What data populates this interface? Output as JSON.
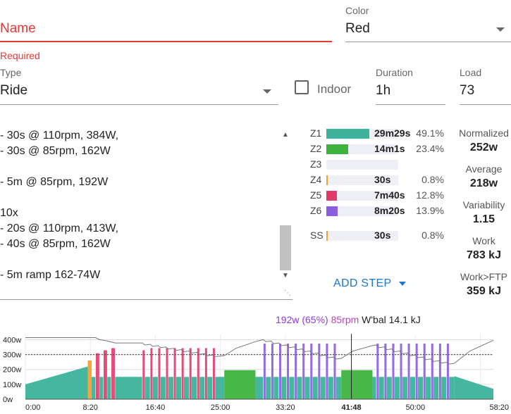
{
  "form": {
    "name_placeholder": "Name",
    "required_text": "Required",
    "color_label": "Color",
    "color_value": "Red",
    "type_label": "Type",
    "type_value": "Ride",
    "indoor_label": "Indoor",
    "indoor_checked": false,
    "duration_label": "Duration",
    "duration_value": "1h",
    "load_label": "Load",
    "load_value": "73"
  },
  "workout_lines": [
    "- 30s @ 110rpm, 384W,",
    "- 30s @ 85rpm, 162W",
    "",
    "- 5m @ 85rpm, 192W",
    "",
    "10x",
    "- 20s @ 110rpm, 413W,",
    "- 40s @ 85rpm, 162W",
    "",
    "- 5m ramp 162-74W"
  ],
  "zones": [
    {
      "label": "Z1",
      "time": "29m29s",
      "pct": "49.1%",
      "fill": 0.6,
      "color": "#3cb39a"
    },
    {
      "label": "Z2",
      "time": "14m1s",
      "pct": "23.4%",
      "fill": 0.3,
      "color": "#3db33d"
    },
    {
      "label": "Z3",
      "time": "",
      "pct": "",
      "fill": 0,
      "color": "#e0b030"
    },
    {
      "label": "Z4",
      "time": "30s",
      "pct": "0.8%",
      "fill": 0.02,
      "color": "#f5a030"
    },
    {
      "label": "Z5",
      "time": "7m40s",
      "pct": "12.8%",
      "fill": 0.15,
      "color": "#e03a6a"
    },
    {
      "label": "Z6",
      "time": "8m20s",
      "pct": "13.9%",
      "fill": 0.16,
      "color": "#8a5ce0"
    }
  ],
  "ss": {
    "label": "SS",
    "time": "30s",
    "pct": "0.8%",
    "fill": 0.02,
    "color": "#f5a030"
  },
  "stats": [
    {
      "label": "Normalized",
      "value": "252w"
    },
    {
      "label": "Average",
      "value": "218w"
    },
    {
      "label": "Variability",
      "value": "1.15"
    },
    {
      "label": "Work",
      "value": "783 kJ"
    },
    {
      "label": "Work>FTP",
      "value": "359 kJ"
    }
  ],
  "add_step_label": "ADD STEP",
  "colors": {
    "accent": "#1976d2",
    "error": "#e53935",
    "z1": "#3cb39a",
    "z2": "#3db33d",
    "z4": "#f5a030",
    "z5": "#e03a6a",
    "z6": "#8a5ce0"
  },
  "chart_header": {
    "power": "192w (65%)",
    "cadence": "85rpm",
    "wbal": "W'bal 14.1 kJ"
  },
  "chart_data": {
    "type": "area",
    "x_unit": "elapsed time",
    "x_tick_labels": [
      "0:00",
      "8:20",
      "16:40",
      "25:00",
      "33:20",
      "41:48",
      "50:00",
      "58:20"
    ],
    "x_tick_minutes": [
      0,
      8.333,
      16.667,
      25,
      33.333,
      41.8,
      50,
      58.333
    ],
    "y_tick_labels": [
      "0w",
      "100w",
      "200w",
      "300w",
      "400w"
    ],
    "ylim": [
      0,
      440
    ],
    "ftp_line_w": 300,
    "cursor_minutes": 41.8,
    "total_minutes": 60,
    "segments": [
      {
        "start": 0,
        "end": 8,
        "from_w": 100,
        "to_w": 220,
        "zone": "z1"
      },
      {
        "start": 8,
        "end": 8.5,
        "from_w": 260,
        "to_w": 260,
        "zone": "z4"
      },
      {
        "start": 8.5,
        "end": 9,
        "from_w": 150,
        "to_w": 150,
        "zone": "z1"
      },
      {
        "start": 9,
        "end": 9.5,
        "from_w": 310,
        "to_w": 310,
        "zone": "z5"
      },
      {
        "start": 9.5,
        "end": 10,
        "from_w": 150,
        "to_w": 150,
        "zone": "z1"
      },
      {
        "start": 10,
        "end": 10.5,
        "from_w": 330,
        "to_w": 330,
        "zone": "z5"
      },
      {
        "start": 10.5,
        "end": 11,
        "from_w": 150,
        "to_w": 150,
        "zone": "z1"
      },
      {
        "start": 11,
        "end": 11.5,
        "from_w": 345,
        "to_w": 345,
        "zone": "z5"
      },
      {
        "start": 11.5,
        "end": 15,
        "from_w": 150,
        "to_w": 150,
        "zone": "z1"
      },
      {
        "start": 15,
        "end": 15.33,
        "from_w": 330,
        "to_w": 330,
        "zone": "z5"
      },
      {
        "start": 15.33,
        "end": 16,
        "from_w": 150,
        "to_w": 150,
        "zone": "z1"
      },
      {
        "start": 16,
        "end": 16.33,
        "from_w": 345,
        "to_w": 345,
        "zone": "z5"
      },
      {
        "start": 16.33,
        "end": 17,
        "from_w": 150,
        "to_w": 150,
        "zone": "z1"
      },
      {
        "start": 17,
        "end": 17.33,
        "from_w": 345,
        "to_w": 345,
        "zone": "z5"
      },
      {
        "start": 17.33,
        "end": 18,
        "from_w": 150,
        "to_w": 150,
        "zone": "z1"
      },
      {
        "start": 18,
        "end": 18.33,
        "from_w": 345,
        "to_w": 345,
        "zone": "z5"
      },
      {
        "start": 18.33,
        "end": 19,
        "from_w": 150,
        "to_w": 150,
        "zone": "z1"
      },
      {
        "start": 19,
        "end": 19.33,
        "from_w": 345,
        "to_w": 345,
        "zone": "z5"
      },
      {
        "start": 19.33,
        "end": 20,
        "from_w": 150,
        "to_w": 150,
        "zone": "z1"
      },
      {
        "start": 20,
        "end": 20.33,
        "from_w": 345,
        "to_w": 345,
        "zone": "z5"
      },
      {
        "start": 20.33,
        "end": 21,
        "from_w": 150,
        "to_w": 150,
        "zone": "z1"
      },
      {
        "start": 21,
        "end": 21.33,
        "from_w": 345,
        "to_w": 345,
        "zone": "z5"
      },
      {
        "start": 21.33,
        "end": 22,
        "from_w": 150,
        "to_w": 150,
        "zone": "z1"
      },
      {
        "start": 22,
        "end": 22.33,
        "from_w": 345,
        "to_w": 345,
        "zone": "z5"
      },
      {
        "start": 22.33,
        "end": 23,
        "from_w": 150,
        "to_w": 150,
        "zone": "z1"
      },
      {
        "start": 23,
        "end": 23.33,
        "from_w": 345,
        "to_w": 345,
        "zone": "z5"
      },
      {
        "start": 23.33,
        "end": 24,
        "from_w": 150,
        "to_w": 150,
        "zone": "z1"
      },
      {
        "start": 24,
        "end": 24.33,
        "from_w": 345,
        "to_w": 345,
        "zone": "z5"
      },
      {
        "start": 24.33,
        "end": 25.5,
        "from_w": 150,
        "to_w": 150,
        "zone": "z1"
      },
      {
        "start": 25.5,
        "end": 29.5,
        "from_w": 195,
        "to_w": 195,
        "zone": "z2"
      },
      {
        "start": 29.5,
        "end": 30.5,
        "from_w": 150,
        "to_w": 150,
        "zone": "z1"
      },
      {
        "start": 30.5,
        "end": 30.83,
        "from_w": 375,
        "to_w": 375,
        "zone": "z6"
      },
      {
        "start": 30.83,
        "end": 31.5,
        "from_w": 150,
        "to_w": 150,
        "zone": "z1"
      },
      {
        "start": 31.5,
        "end": 31.83,
        "from_w": 375,
        "to_w": 375,
        "zone": "z6"
      },
      {
        "start": 31.83,
        "end": 32.5,
        "from_w": 150,
        "to_w": 150,
        "zone": "z1"
      },
      {
        "start": 32.5,
        "end": 32.83,
        "from_w": 375,
        "to_w": 375,
        "zone": "z6"
      },
      {
        "start": 32.83,
        "end": 33.5,
        "from_w": 150,
        "to_w": 150,
        "zone": "z1"
      },
      {
        "start": 33.5,
        "end": 33.83,
        "from_w": 375,
        "to_w": 375,
        "zone": "z6"
      },
      {
        "start": 33.83,
        "end": 34.5,
        "from_w": 150,
        "to_w": 150,
        "zone": "z1"
      },
      {
        "start": 34.5,
        "end": 34.83,
        "from_w": 375,
        "to_w": 375,
        "zone": "z6"
      },
      {
        "start": 34.83,
        "end": 35.5,
        "from_w": 150,
        "to_w": 150,
        "zone": "z1"
      },
      {
        "start": 35.5,
        "end": 35.83,
        "from_w": 375,
        "to_w": 375,
        "zone": "z6"
      },
      {
        "start": 35.83,
        "end": 36.5,
        "from_w": 150,
        "to_w": 150,
        "zone": "z1"
      },
      {
        "start": 36.5,
        "end": 36.83,
        "from_w": 375,
        "to_w": 375,
        "zone": "z6"
      },
      {
        "start": 36.83,
        "end": 37.5,
        "from_w": 150,
        "to_w": 150,
        "zone": "z1"
      },
      {
        "start": 37.5,
        "end": 37.83,
        "from_w": 375,
        "to_w": 375,
        "zone": "z6"
      },
      {
        "start": 37.83,
        "end": 38.5,
        "from_w": 150,
        "to_w": 150,
        "zone": "z1"
      },
      {
        "start": 38.5,
        "end": 38.83,
        "from_w": 375,
        "to_w": 375,
        "zone": "z6"
      },
      {
        "start": 38.83,
        "end": 39.5,
        "from_w": 150,
        "to_w": 150,
        "zone": "z1"
      },
      {
        "start": 39.5,
        "end": 39.83,
        "from_w": 375,
        "to_w": 375,
        "zone": "z6"
      },
      {
        "start": 39.83,
        "end": 40.5,
        "from_w": 150,
        "to_w": 150,
        "zone": "z1"
      },
      {
        "start": 40.5,
        "end": 44.5,
        "from_w": 195,
        "to_w": 195,
        "zone": "z2"
      },
      {
        "start": 44.5,
        "end": 45,
        "from_w": 150,
        "to_w": 150,
        "zone": "z1"
      },
      {
        "start": 45,
        "end": 45.33,
        "from_w": 375,
        "to_w": 375,
        "zone": "z6"
      },
      {
        "start": 45.33,
        "end": 46,
        "from_w": 150,
        "to_w": 150,
        "zone": "z1"
      },
      {
        "start": 46,
        "end": 46.33,
        "from_w": 375,
        "to_w": 375,
        "zone": "z6"
      },
      {
        "start": 46.33,
        "end": 47,
        "from_w": 150,
        "to_w": 150,
        "zone": "z1"
      },
      {
        "start": 47,
        "end": 47.33,
        "from_w": 375,
        "to_w": 375,
        "zone": "z6"
      },
      {
        "start": 47.33,
        "end": 48,
        "from_w": 150,
        "to_w": 150,
        "zone": "z1"
      },
      {
        "start": 48,
        "end": 48.33,
        "from_w": 375,
        "to_w": 375,
        "zone": "z6"
      },
      {
        "start": 48.33,
        "end": 49,
        "from_w": 150,
        "to_w": 150,
        "zone": "z1"
      },
      {
        "start": 49,
        "end": 49.33,
        "from_w": 375,
        "to_w": 375,
        "zone": "z6"
      },
      {
        "start": 49.33,
        "end": 50,
        "from_w": 150,
        "to_w": 150,
        "zone": "z1"
      },
      {
        "start": 50,
        "end": 50.33,
        "from_w": 375,
        "to_w": 375,
        "zone": "z6"
      },
      {
        "start": 50.33,
        "end": 51,
        "from_w": 150,
        "to_w": 150,
        "zone": "z1"
      },
      {
        "start": 51,
        "end": 51.33,
        "from_w": 375,
        "to_w": 375,
        "zone": "z6"
      },
      {
        "start": 51.33,
        "end": 52,
        "from_w": 150,
        "to_w": 150,
        "zone": "z1"
      },
      {
        "start": 52,
        "end": 52.33,
        "from_w": 375,
        "to_w": 375,
        "zone": "z6"
      },
      {
        "start": 52.33,
        "end": 53,
        "from_w": 150,
        "to_w": 150,
        "zone": "z1"
      },
      {
        "start": 53,
        "end": 53.33,
        "from_w": 375,
        "to_w": 375,
        "zone": "z6"
      },
      {
        "start": 53.33,
        "end": 54,
        "from_w": 150,
        "to_w": 150,
        "zone": "z1"
      },
      {
        "start": 54,
        "end": 54.33,
        "from_w": 375,
        "to_w": 375,
        "zone": "z6"
      },
      {
        "start": 54.33,
        "end": 55,
        "from_w": 150,
        "to_w": 150,
        "zone": "z1"
      },
      {
        "start": 55,
        "end": 60,
        "from_w": 155,
        "to_w": 70,
        "zone": "z1"
      }
    ],
    "wbal_points": [
      [
        0,
        470
      ],
      [
        9,
        470
      ],
      [
        9.5,
        445
      ],
      [
        10.5,
        435
      ],
      [
        11.5,
        420
      ],
      [
        15,
        420
      ],
      [
        15.33,
        405
      ],
      [
        16,
        410
      ],
      [
        16.33,
        395
      ],
      [
        17,
        400
      ],
      [
        17.33,
        385
      ],
      [
        18,
        390
      ],
      [
        18.33,
        375
      ],
      [
        19,
        380
      ],
      [
        19.33,
        365
      ],
      [
        20,
        370
      ],
      [
        20.33,
        355
      ],
      [
        21,
        360
      ],
      [
        21.33,
        345
      ],
      [
        22,
        350
      ],
      [
        22.33,
        335
      ],
      [
        23,
        340
      ],
      [
        23.33,
        325
      ],
      [
        24,
        330
      ],
      [
        24.33,
        318
      ],
      [
        25.5,
        325
      ],
      [
        27,
        380
      ],
      [
        29.5,
        430
      ],
      [
        30.5,
        445
      ],
      [
        30.83,
        430
      ],
      [
        31.5,
        435
      ],
      [
        31.83,
        415
      ],
      [
        32.5,
        420
      ],
      [
        32.83,
        400
      ],
      [
        33.5,
        405
      ],
      [
        33.83,
        385
      ],
      [
        34.5,
        390
      ],
      [
        34.83,
        370
      ],
      [
        35.5,
        375
      ],
      [
        35.83,
        355
      ],
      [
        36.5,
        360
      ],
      [
        36.83,
        340
      ],
      [
        37.5,
        345
      ],
      [
        37.83,
        325
      ],
      [
        38.5,
        330
      ],
      [
        38.83,
        310
      ],
      [
        39.5,
        315
      ],
      [
        39.83,
        300
      ],
      [
        40.5,
        305
      ],
      [
        42,
        360
      ],
      [
        44.5,
        400
      ],
      [
        45,
        405
      ],
      [
        45.33,
        385
      ],
      [
        46,
        390
      ],
      [
        46.33,
        370
      ],
      [
        47,
        375
      ],
      [
        47.33,
        355
      ],
      [
        48,
        360
      ],
      [
        48.33,
        340
      ],
      [
        49,
        345
      ],
      [
        49.33,
        325
      ],
      [
        50,
        330
      ],
      [
        50.33,
        310
      ],
      [
        51,
        315
      ],
      [
        51.33,
        295
      ],
      [
        52,
        300
      ],
      [
        52.33,
        282
      ],
      [
        53,
        287
      ],
      [
        53.33,
        270
      ],
      [
        54,
        275
      ],
      [
        54.33,
        262
      ],
      [
        55,
        268
      ],
      [
        57,
        360
      ],
      [
        60,
        440
      ]
    ]
  }
}
